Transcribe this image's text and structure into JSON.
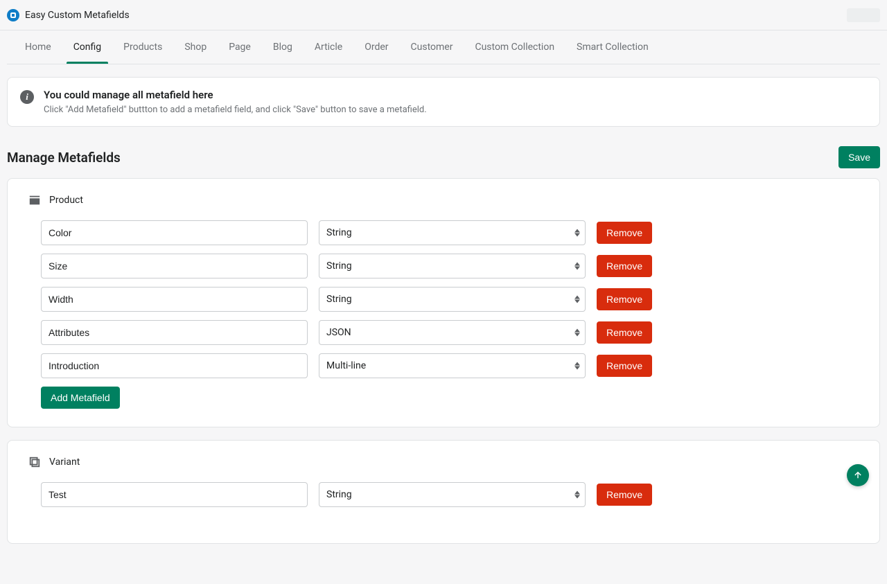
{
  "header": {
    "appTitle": "Easy Custom Metafields"
  },
  "tabs": [
    {
      "label": "Home",
      "active": false
    },
    {
      "label": "Config",
      "active": true
    },
    {
      "label": "Products",
      "active": false
    },
    {
      "label": "Shop",
      "active": false
    },
    {
      "label": "Page",
      "active": false
    },
    {
      "label": "Blog",
      "active": false
    },
    {
      "label": "Article",
      "active": false
    },
    {
      "label": "Order",
      "active": false
    },
    {
      "label": "Customer",
      "active": false
    },
    {
      "label": "Custom Collection",
      "active": false
    },
    {
      "label": "Smart Collection",
      "active": false
    }
  ],
  "info": {
    "title": "You could manage all metafield here",
    "subtitle": "Click \"Add Metafield\" buttton to add a metafield field, and click \"Save\" button to save a metafield."
  },
  "pageHeading": "Manage Metafields",
  "saveLabel": "Save",
  "addMetafieldLabel": "Add Metafield",
  "removeLabel": "Remove",
  "sections": [
    {
      "title": "Product",
      "fields": [
        {
          "name": "Color",
          "type": "String"
        },
        {
          "name": "Size",
          "type": "String"
        },
        {
          "name": "Width",
          "type": "String"
        },
        {
          "name": "Attributes",
          "type": "JSON"
        },
        {
          "name": "Introduction",
          "type": "Multi-line"
        }
      ]
    },
    {
      "title": "Variant",
      "fields": [
        {
          "name": "Test",
          "type": "String"
        }
      ]
    }
  ]
}
